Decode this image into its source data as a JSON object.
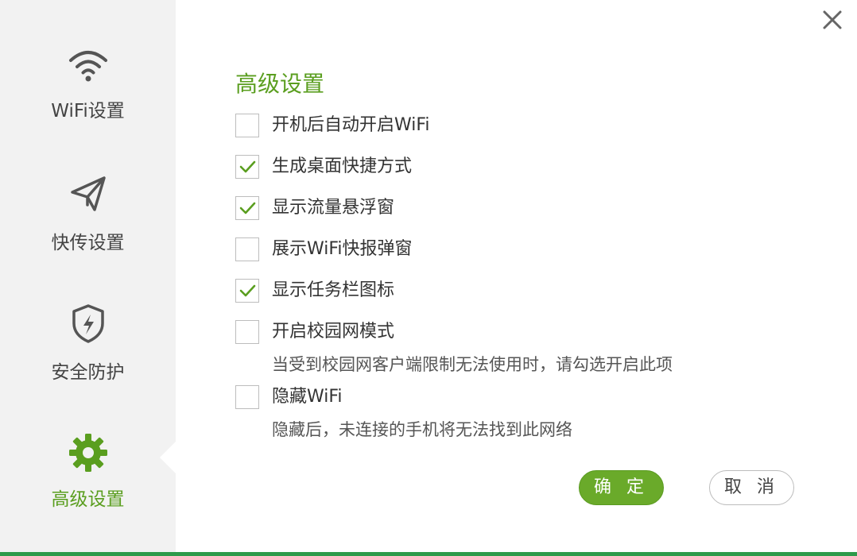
{
  "colors": {
    "accent": "#5a9e1f",
    "button_primary": "#6aaa2a",
    "sidebar_bg": "#f2f2f2",
    "bottom_bar": "#2e9a4a"
  },
  "sidebar": {
    "items": [
      {
        "label": "WiFi设置",
        "icon": "wifi-icon",
        "active": false
      },
      {
        "label": "快传设置",
        "icon": "paper-plane-icon",
        "active": false
      },
      {
        "label": "安全防护",
        "icon": "shield-bolt-icon",
        "active": false
      },
      {
        "label": "高级设置",
        "icon": "gear-icon",
        "active": true
      }
    ]
  },
  "window": {
    "close_icon": "close-icon"
  },
  "main": {
    "title": "高级设置",
    "options": [
      {
        "label": "开机后自动开启WiFi",
        "checked": false
      },
      {
        "label": "生成桌面快捷方式",
        "checked": true
      },
      {
        "label": "显示流量悬浮窗",
        "checked": true
      },
      {
        "label": "展示WiFi快报弹窗",
        "checked": false
      },
      {
        "label": "显示任务栏图标",
        "checked": true
      },
      {
        "label": "开启校园网模式",
        "checked": false,
        "hint": "当受到校园网客户端限制无法使用时，请勾选开启此项"
      },
      {
        "label": "隐藏WiFi",
        "checked": false,
        "hint": "隐藏后，未连接的手机将无法找到此网络"
      }
    ]
  },
  "footer": {
    "confirm_label": "确 定",
    "cancel_label": "取 消"
  }
}
